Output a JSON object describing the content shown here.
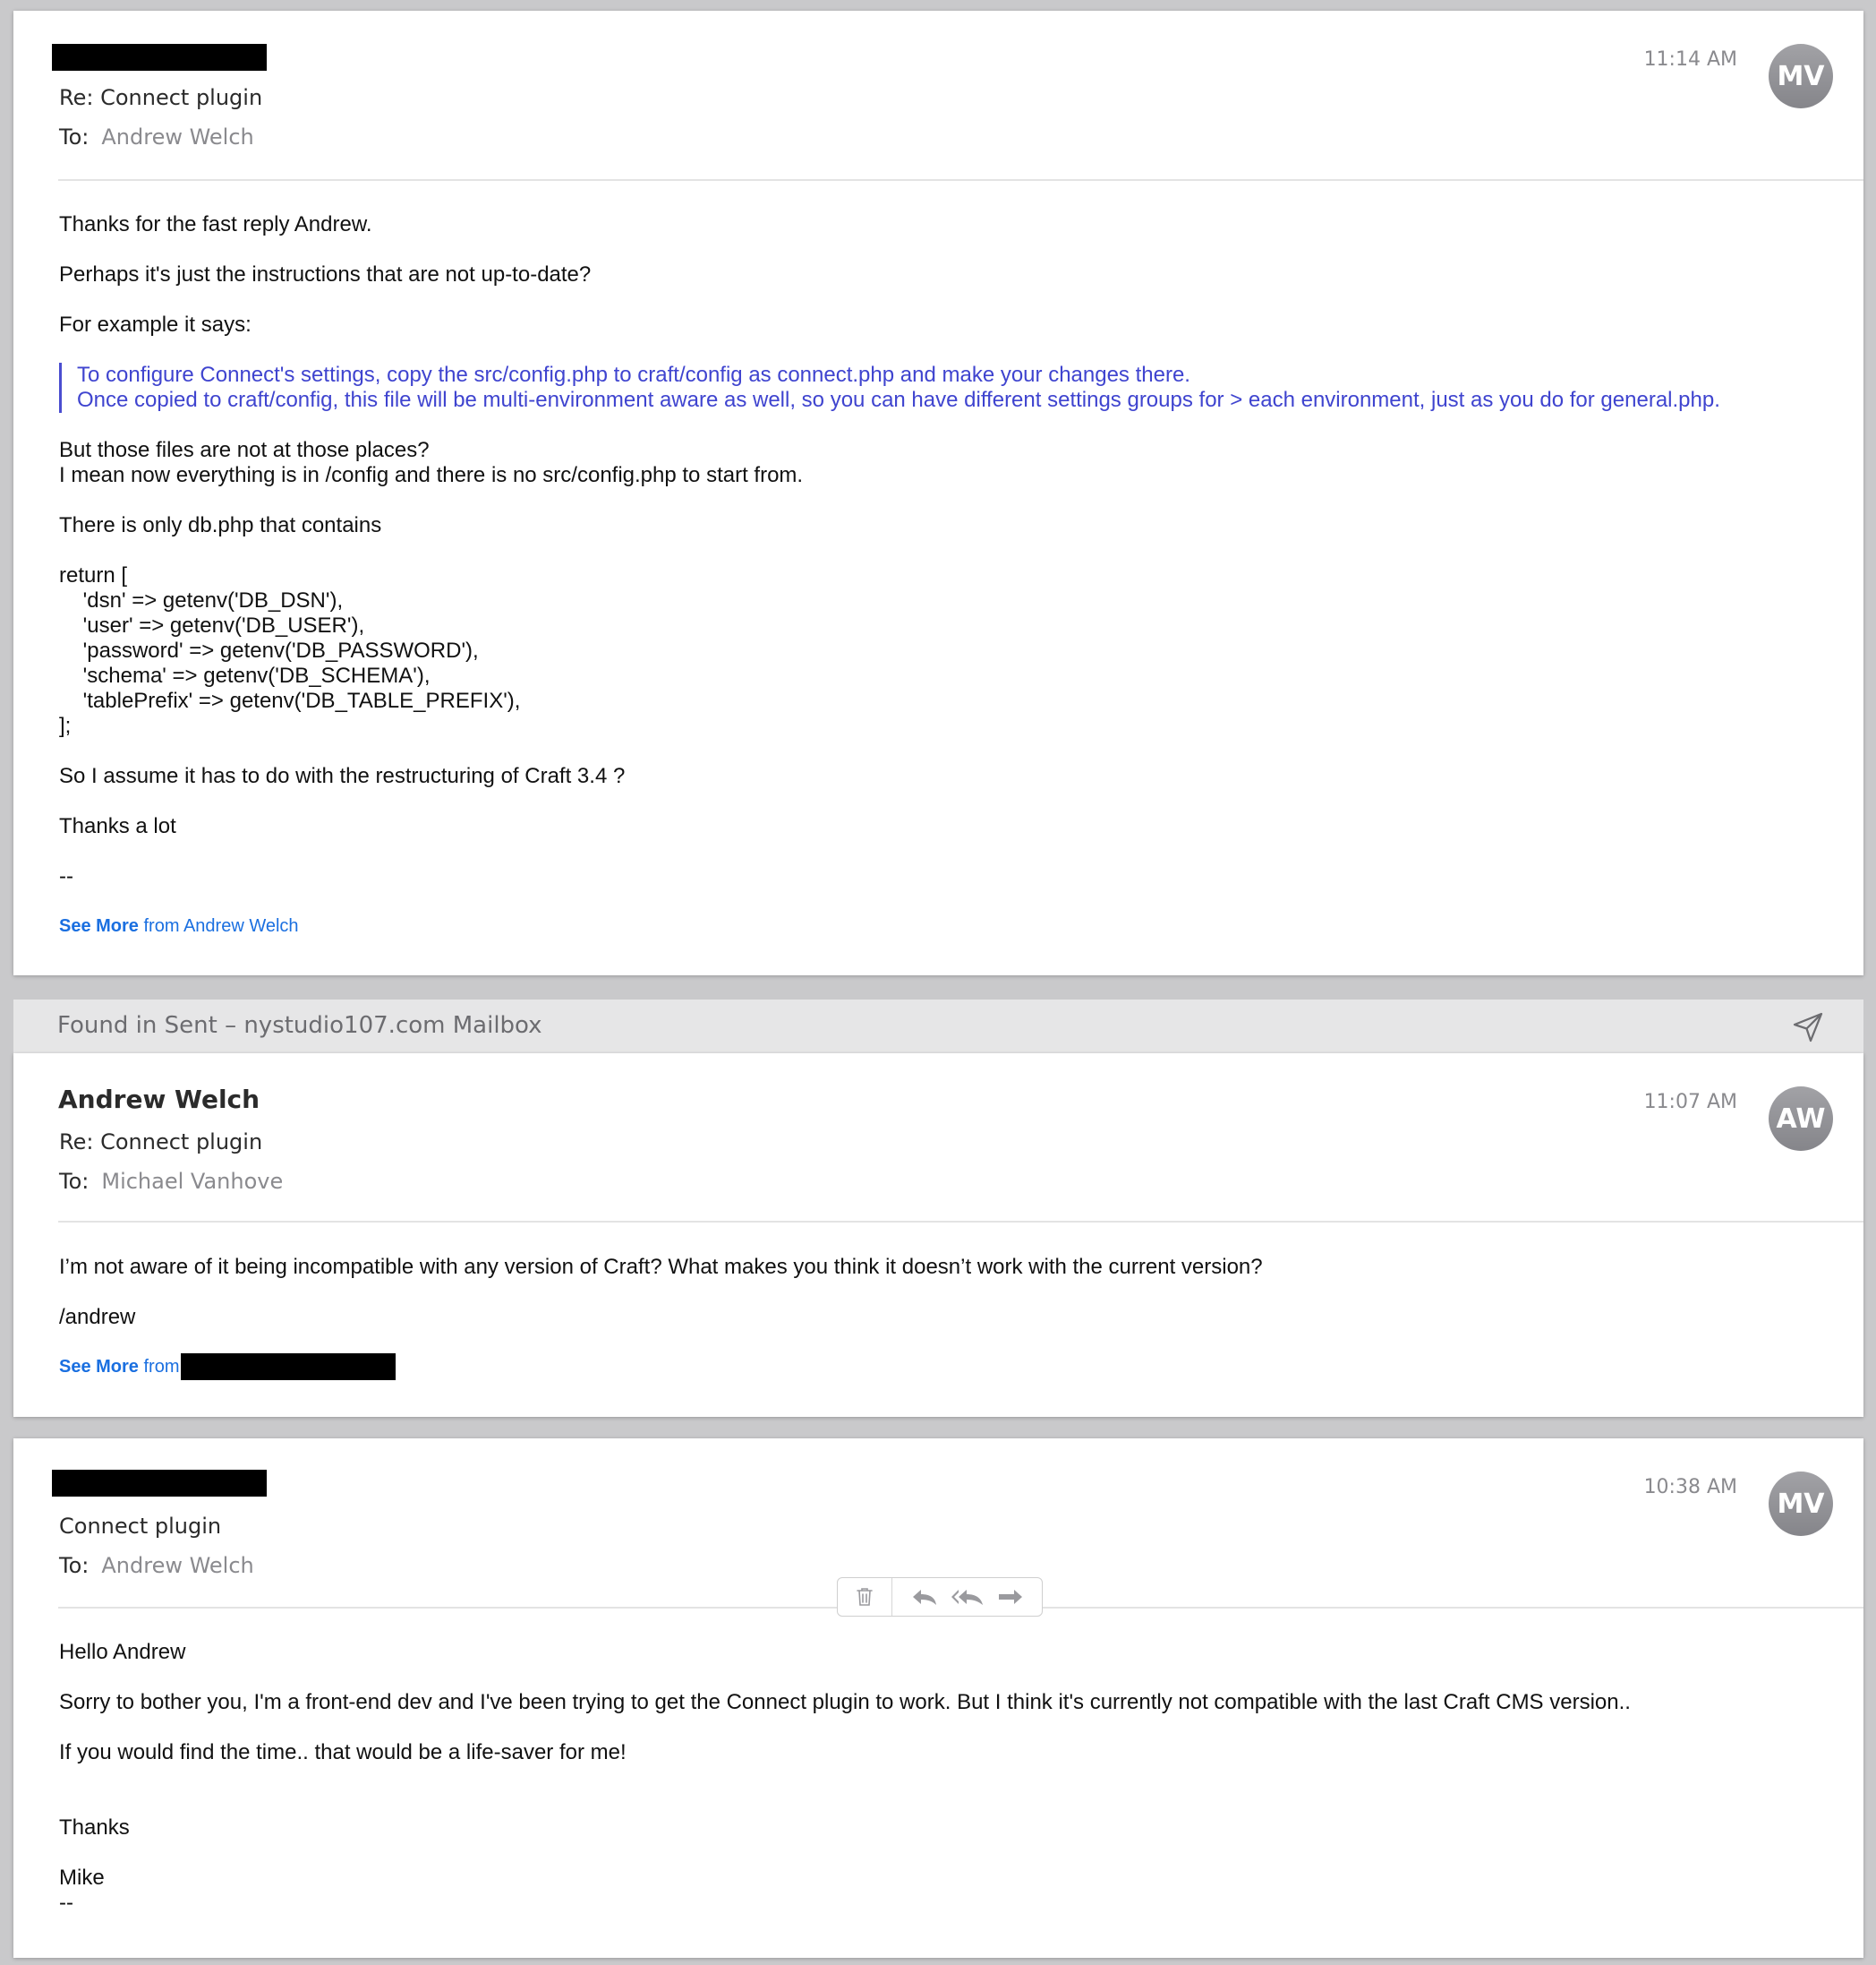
{
  "mailbox_banner": {
    "text": "Found in Sent – nystudio107.com Mailbox"
  },
  "message1": {
    "time": "11:14 AM",
    "avatar": "MV",
    "subject": "Re: Connect plugin",
    "to_label": "To:",
    "to_name": "Andrew Welch",
    "body": {
      "p1": "Thanks for the fast reply Andrew.",
      "p2": "Perhaps it's just the instructions that are not up-to-date?",
      "p3": "For example it says:",
      "quote1": "To configure Connect's settings, copy the src/config.php to craft/config as connect.php and make your changes there.",
      "quote2": "Once copied to craft/config, this file will be multi-environment aware as well, so you can have different settings groups for > each environment, just as you do for general.php.",
      "p4a": "But those files are not at those places?",
      "p4b": "I mean now everything is in /config and there is no src/config.php to start from.",
      "p5": "There is only db.php that contains",
      "code": [
        "return [",
        "    'dsn' => getenv('DB_DSN'),",
        "    'user' => getenv('DB_USER'),",
        "    'password' => getenv('DB_PASSWORD'),",
        "    'schema' => getenv('DB_SCHEMA'),",
        "    'tablePrefix' => getenv('DB_TABLE_PREFIX'),",
        "];"
      ],
      "p6": "So I assume it has to do with the restructuring of Craft 3.4 ?",
      "p7": "Thanks a lot",
      "p8": "--"
    },
    "see_more": "See More",
    "see_more_from": "from Andrew Welch"
  },
  "message2": {
    "sender": "Andrew Welch",
    "time": "11:07 AM",
    "avatar": "AW",
    "subject": "Re: Connect plugin",
    "to_label": "To:",
    "to_name": "Michael Vanhove",
    "body": {
      "p1": "I’m not aware of it being incompatible with any version of Craft? What makes you think it doesn’t work with the current version?",
      "p2": "/andrew"
    },
    "see_more": "See More",
    "see_more_from": "from"
  },
  "message3": {
    "time": "10:38 AM",
    "avatar": "MV",
    "subject": "Connect plugin",
    "to_label": "To:",
    "to_name": "Andrew Welch",
    "body": {
      "p1": "Hello Andrew",
      "p2": "Sorry to bother you, I'm a front-end dev and I've been trying to get the Connect plugin to work. But I think it's currently not compatible with the last Craft CMS version..",
      "p3": "If you would find the time.. that would be a life-saver for me!",
      "p4": "Thanks",
      "p5": "Mike",
      "p6": "--"
    },
    "toolbar_icons": [
      "trash-icon",
      "reply-icon",
      "reply-all-icon",
      "forward-icon"
    ]
  },
  "colors": {
    "quote": "#3f44cf",
    "link": "#1a6fe0",
    "avatar": "#8e8e93",
    "meta": "#8a8a8e"
  }
}
